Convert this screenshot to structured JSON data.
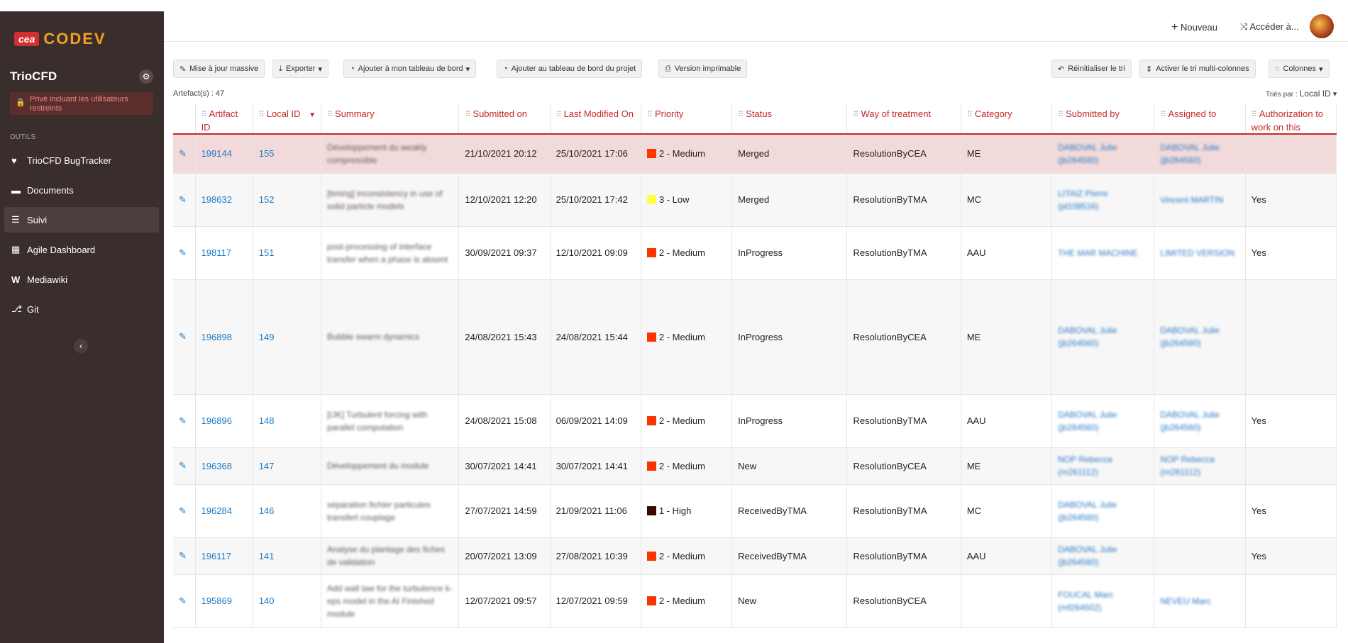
{
  "brand": {
    "logo_box": "cea",
    "logo_text": "CODEV"
  },
  "project": {
    "name": "TrioCFD",
    "privacy": "Privé incluant les utilisateurs restreints"
  },
  "sidebar": {
    "section": "OUTILS",
    "items": [
      {
        "label": "TrioCFD BugTracker",
        "icon": "heart-icon"
      },
      {
        "label": "Documents",
        "icon": "folder-icon"
      },
      {
        "label": "Suivi",
        "icon": "list-icon"
      },
      {
        "label": "Agile Dashboard",
        "icon": "table-icon"
      },
      {
        "label": "Mediawiki",
        "icon": "wiki-icon"
      },
      {
        "label": "Git",
        "icon": "git-icon"
      }
    ]
  },
  "topbar": {
    "new_label": "Nouveau",
    "goto_label": "Accéder à..."
  },
  "toolbar": {
    "mass_update": "Mise à jour massive",
    "export": "Exporter",
    "add_my_dashboard": "Ajouter à mon tableau de bord",
    "add_project_dashboard": "Ajouter au tableau de bord du projet",
    "print_version": "Version imprimable",
    "reset_sort": "Réinitialiser le tri",
    "multi_sort": "Activer le tri multi-colonnes",
    "columns": "Colonnes"
  },
  "meta": {
    "artifacts_label": "Artefact(s) :",
    "artifacts_count": "47",
    "sorted_label": "Triés par :",
    "sorted_value": "Local ID"
  },
  "table": {
    "headers": [
      "Artifact ID",
      "Local ID",
      "Summary",
      "Submitted on",
      "Last Modified On",
      "Priority",
      "Status",
      "Way of treatment",
      "Category",
      "Submitted by",
      "Assigned to",
      "Authorization to work on this"
    ],
    "rows": [
      {
        "artifact_id": "199144",
        "local_id": "155",
        "summary": "Développement du weakly compressible",
        "submitted_on": "21/10/2021 20:12",
        "modified_on": "25/10/2021 17:06",
        "priority": "2 - Medium",
        "priority_color": "#ff3300",
        "status": "Merged",
        "way": "ResolutionByCEA",
        "category": "ME",
        "submitted_by": "DABOVAL Julie (jb264560)",
        "assigned_to": "DABOVAL Julie (jb264560)",
        "authorization": ""
      },
      {
        "artifact_id": "198632",
        "local_id": "152",
        "summary": "[timing] inconsistency in use of solid particle models",
        "submitted_on": "12/10/2021 12:20",
        "modified_on": "25/10/2021 17:42",
        "priority": "3 - Low",
        "priority_color": "#ffff44",
        "status": "Merged",
        "way": "ResolutionByTMA",
        "category": "MC",
        "submitted_by": "LITAIZ Pierre (pl108516)",
        "assigned_to": "Vincent MARTIN",
        "authorization": "Yes"
      },
      {
        "artifact_id": "198117",
        "local_id": "151",
        "summary": "post-processing of interface transfer when a phase is absent",
        "submitted_on": "30/09/2021 09:37",
        "modified_on": "12/10/2021 09:09",
        "priority": "2 - Medium",
        "priority_color": "#ff3300",
        "status": "InProgress",
        "way": "ResolutionByTMA",
        "category": "AAU",
        "submitted_by": "THE MAR MACHINE",
        "assigned_to": "LIMITED VERSION",
        "authorization": "Yes"
      },
      {
        "artifact_id": "196898",
        "local_id": "149",
        "summary": "Bubble swarm dynamics",
        "submitted_on": "24/08/2021 15:43",
        "modified_on": "24/08/2021 15:44",
        "priority": "2 - Medium",
        "priority_color": "#ff3300",
        "status": "InProgress",
        "way": "ResolutionByCEA",
        "category": "ME",
        "submitted_by": "DABOVAL Julie (jb264560)",
        "assigned_to": "DABOVAL Julie (jb264560)",
        "authorization": ""
      },
      {
        "artifact_id": "196896",
        "local_id": "148",
        "summary": "[IJK] Turbulent forcing with parallel computation",
        "submitted_on": "24/08/2021 15:08",
        "modified_on": "06/09/2021 14:09",
        "priority": "2 - Medium",
        "priority_color": "#ff3300",
        "status": "InProgress",
        "way": "ResolutionByTMA",
        "category": "AAU",
        "submitted_by": "DABOVAL Julie (jb264560)",
        "assigned_to": "DABOVAL Julie (jb264560)",
        "authorization": "Yes"
      },
      {
        "artifact_id": "196368",
        "local_id": "147",
        "summary": "Développement du module",
        "submitted_on": "30/07/2021 14:41",
        "modified_on": "30/07/2021 14:41",
        "priority": "2 - Medium",
        "priority_color": "#ff3300",
        "status": "New",
        "way": "ResolutionByCEA",
        "category": "ME",
        "submitted_by": "NOP Rebecca (rn261112)",
        "assigned_to": "NOP Rebecca (rn261112)",
        "authorization": ""
      },
      {
        "artifact_id": "196284",
        "local_id": "146",
        "summary": "séparation fichier particules transfert couplage",
        "submitted_on": "27/07/2021 14:59",
        "modified_on": "21/09/2021 11:06",
        "priority": "1 - High",
        "priority_color": "#3a0a00",
        "status": "ReceivedByTMA",
        "way": "ResolutionByTMA",
        "category": "MC",
        "submitted_by": "DABOVAL Julie (jb264560)",
        "assigned_to": "",
        "authorization": "Yes"
      },
      {
        "artifact_id": "196117",
        "local_id": "141",
        "summary": "Analyse du plantage des fiches de validation",
        "submitted_on": "20/07/2021 13:09",
        "modified_on": "27/08/2021 10:39",
        "priority": "2 - Medium",
        "priority_color": "#ff3300",
        "status": "ReceivedByTMA",
        "way": "ResolutionByTMA",
        "category": "AAU",
        "submitted_by": "DABOVAL Julie (jb264560)",
        "assigned_to": "",
        "authorization": "Yes"
      },
      {
        "artifact_id": "195869",
        "local_id": "140",
        "summary": "Add wall law for the turbulence k-eps model in the AI Finished module",
        "submitted_on": "12/07/2021 09:57",
        "modified_on": "12/07/2021 09:59",
        "priority": "2 - Medium",
        "priority_color": "#ff3300",
        "status": "New",
        "way": "ResolutionByCEA",
        "category": "",
        "submitted_by": "FOUCAL Marc (mf264502)",
        "assigned_to": "NEVEU Marc",
        "authorization": ""
      }
    ]
  }
}
